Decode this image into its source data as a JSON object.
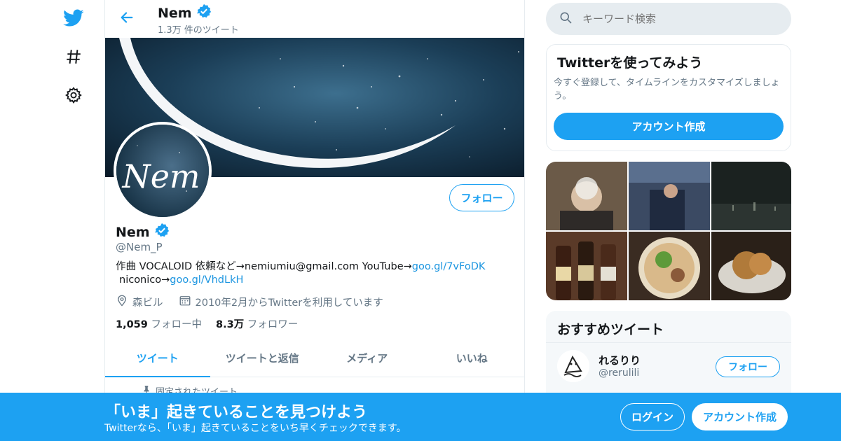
{
  "header": {
    "name": "Nem",
    "tweet_count": "1.3万 件のツイート"
  },
  "profile": {
    "avatar_text": "Nem",
    "follow_label": "フォロー",
    "name": "Nem",
    "handle": "@Nem_P",
    "bio_text": "作曲 VOCALOID 依頼など→nemiumiu@gmail.com YouTube→",
    "bio_link1": "goo.gl/7vFoDK",
    "bio_text2": "niconico→",
    "bio_link2": "goo.gl/VhdLkH",
    "location": "森ビル",
    "joined": "2010年2月からTwitterを利用しています",
    "following_count": "1,059",
    "following_label": "フォロー中",
    "followers_count": "8.3万",
    "followers_label": "フォロワー"
  },
  "tabs": [
    {
      "label": "ツイート",
      "active": true
    },
    {
      "label": "ツイートと返信",
      "active": false
    },
    {
      "label": "メディア",
      "active": false
    },
    {
      "label": "いいね",
      "active": false
    }
  ],
  "pinned_label": "固定されたツイート",
  "search": {
    "placeholder": "キーワード検索"
  },
  "signup_card": {
    "title": "Twitterを使ってみよう",
    "description": "今すぐ登録して、タイムラインをカスタマイズしましょう。",
    "button": "アカウント作成"
  },
  "recommended": {
    "title": "おすすめツイート",
    "user_name": "れるりり",
    "user_handle": "@rerulili",
    "follow_label": "フォロー"
  },
  "bottom_bar": {
    "title": "「いま」起きていることを見つけよう",
    "subtitle": "Twitterなら、「いま」起きていることをいち早くチェックできます。",
    "login": "ログイン",
    "signup": "アカウント作成"
  },
  "colors": {
    "accent": "#1da1f2",
    "link": "#1b95e0",
    "secondary_text": "#657786"
  },
  "icons": [
    "twitter-bird-icon",
    "hashtag-icon",
    "gear-icon",
    "back-arrow-icon",
    "verified-badge-icon",
    "location-icon",
    "calendar-icon",
    "pin-icon",
    "search-icon"
  ]
}
